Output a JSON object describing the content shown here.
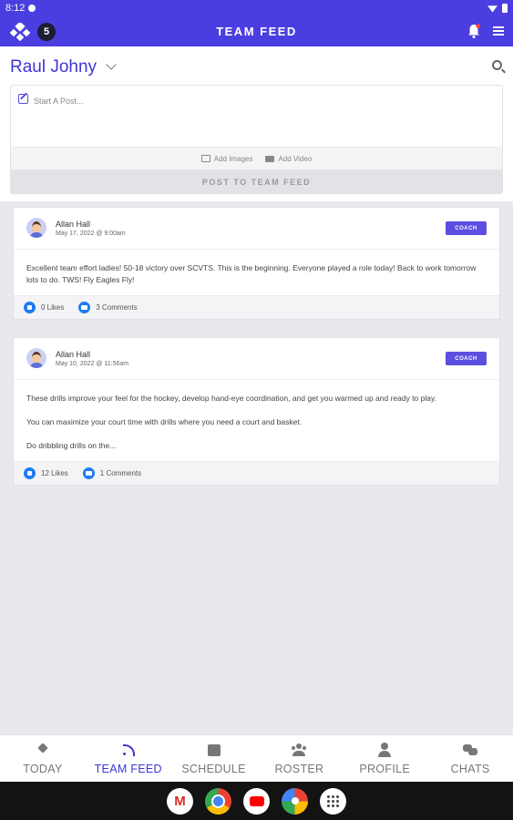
{
  "status_bar": {
    "time": "8:12"
  },
  "app_bar": {
    "team_badge": "5",
    "title": "TEAM FEED"
  },
  "header": {
    "user_name": "Raul Johny"
  },
  "composer": {
    "placeholder": "Start A Post...",
    "add_images_label": "Add Images",
    "add_video_label": "Add Video",
    "post_button_label": "POST TO TEAM FEED"
  },
  "posts": [
    {
      "author": "Allan Hall",
      "date": "May 17, 2022 @ 9:00am",
      "badge": "COACH",
      "paragraphs": [
        "Excellent team effort ladies! 50-18 victory over SCVTS. This is the beginning. Everyone played a role today! Back to work tomorrow lots to do. TWS! Fly Eagles Fly!"
      ],
      "likes": "0 Likes",
      "comments": "3 Comments"
    },
    {
      "author": "Allan Hall",
      "date": "May 10, 2022 @ 11:56am",
      "badge": "COACH",
      "paragraphs": [
        "These drills improve your feel for the hockey, develop hand-eye coordination, and get you warmed up and ready to play.",
        "You can maximize your court time with drills where you need a court and basket.",
        "Do dribbling drills on the..."
      ],
      "likes": "12 Likes",
      "comments": "1 Comments"
    }
  ],
  "bottom_nav": [
    {
      "label": "TODAY",
      "icon": "today-icon",
      "active": false
    },
    {
      "label": "TEAM FEED",
      "icon": "feed-icon",
      "active": true
    },
    {
      "label": "SCHEDULE",
      "icon": "calendar-icon",
      "active": false
    },
    {
      "label": "ROSTER",
      "icon": "roster-icon",
      "active": false
    },
    {
      "label": "PROFILE",
      "icon": "profile-icon",
      "active": false
    },
    {
      "label": "CHATS",
      "icon": "chats-icon",
      "active": false
    }
  ],
  "dock_apps": [
    {
      "name": "gmail-icon",
      "glyph": "M"
    },
    {
      "name": "chrome-icon",
      "glyph": ""
    },
    {
      "name": "youtube-icon",
      "glyph": ""
    },
    {
      "name": "photos-icon",
      "glyph": ""
    },
    {
      "name": "app-drawer-icon",
      "glyph": ""
    }
  ],
  "colors": {
    "primary": "#4b3ee0",
    "accent_text": "#3f36d6",
    "like_blue": "#1e7bf2",
    "background": "#e8e9ee"
  }
}
